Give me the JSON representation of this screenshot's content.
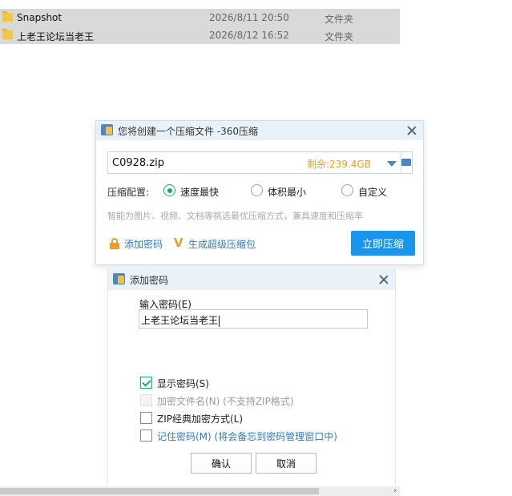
{
  "files": [
    {
      "name": "Snapshot",
      "date": "2026/8/11 20:50",
      "type": "文件夹"
    },
    {
      "name": "上老王论坛当老王",
      "date": "2026/8/12 16:52",
      "type": "文件夹"
    }
  ],
  "compress_dialog": {
    "title": "您将创建一个压缩文件 -360压缩",
    "filename": "C0928.zip",
    "free_space": "剩余:239.4GB",
    "config_label": "压缩配置:",
    "options": [
      {
        "label": "速度最快",
        "checked": true
      },
      {
        "label": "体积最小",
        "checked": false
      },
      {
        "label": "自定义",
        "checked": false
      }
    ],
    "hint": "智能为图片、视频、文档等挑选最优压缩方式，兼具速度和压缩率",
    "add_password_label": "添加密码",
    "super_pack_label": "生成超级压缩包",
    "compress_button": "立即压缩"
  },
  "password_dialog": {
    "title": "添加密码",
    "input_label": "输入密码(E)",
    "password_value": "上老王论坛当老王",
    "options": [
      {
        "label": "显示密码(S)",
        "checked": true,
        "disabled": false
      },
      {
        "label": "加密文件名(N) (不支持ZIP格式)",
        "checked": false,
        "disabled": true
      },
      {
        "label": "ZIP经典加密方式(L)",
        "checked": false,
        "disabled": false
      },
      {
        "label": "记住密码(M) (将会备忘到密码管理窗口中)",
        "checked": false,
        "disabled": false
      }
    ],
    "ok_button": "确认",
    "cancel_button": "取消"
  },
  "colors": {
    "accent": "#1a95ec",
    "link": "#2d7ec9",
    "warning": "#e8a02b",
    "check": "#19a974"
  },
  "icons": [
    "folder-icon",
    "app-icon",
    "close-icon",
    "dropdown-arrow-icon",
    "browse-folder-icon",
    "lock-icon",
    "v-icon",
    "scroll-right-icon"
  ]
}
